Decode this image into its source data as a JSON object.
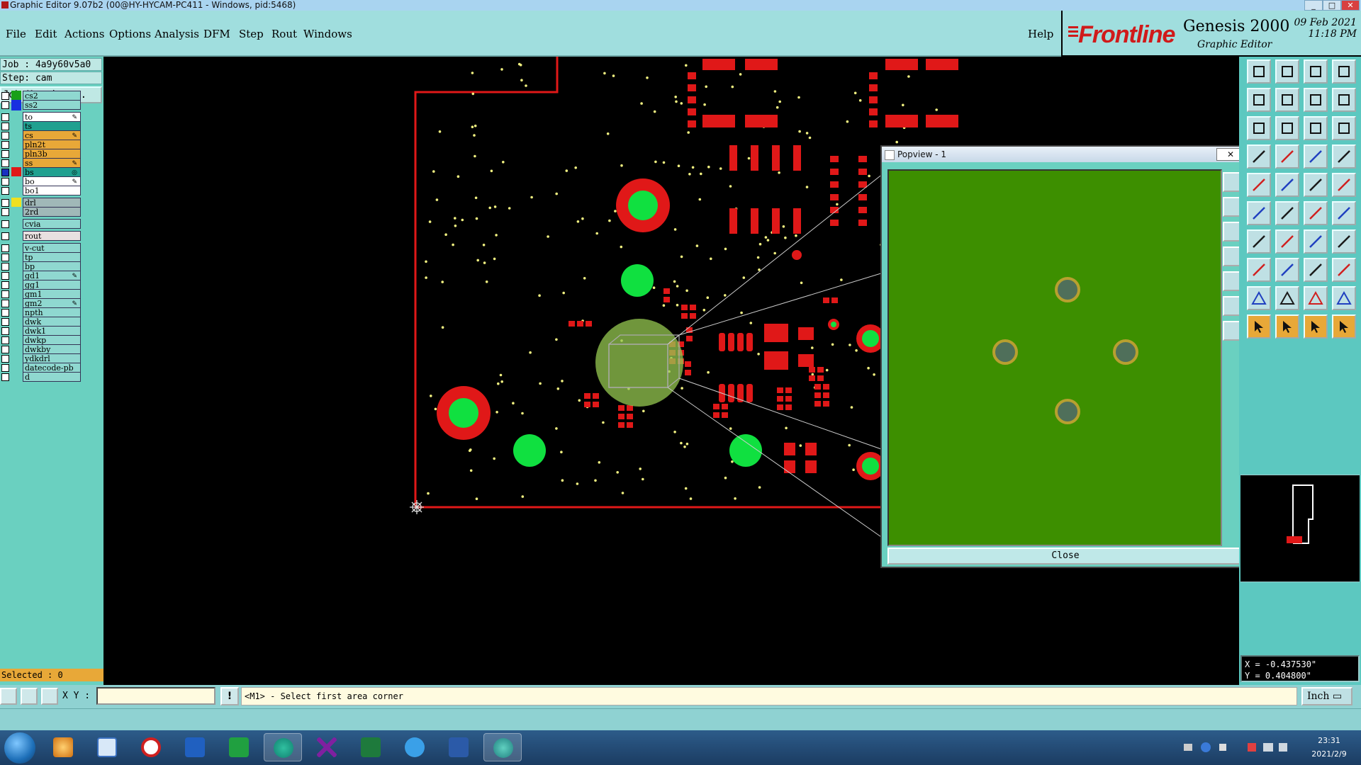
{
  "window": {
    "title": "Graphic Editor 9.07b2 (00@HY-HYCAM-PC411 - Windows, pid:5468)",
    "controls": [
      "_",
      "□",
      "✕"
    ]
  },
  "menu": [
    "File",
    "Edit",
    "Actions",
    "Options",
    "Analysis",
    "DFM",
    "Step",
    "Rout",
    "Windows"
  ],
  "help": "Help",
  "brand": {
    "logo": "Frontline",
    "product": "Genesis 2000",
    "subtitle": "Graphic Editor",
    "date_line1": "09 Feb 2021",
    "date_line2": "11:18 PM"
  },
  "job": {
    "job_label": "Job : 4a9y60v5a0",
    "step_label": "Step: cam",
    "matrix_button": "Job Matrix ..."
  },
  "layers": [
    {
      "name": "cs2",
      "swatch": "#18a018",
      "bg": "#8fd8d0",
      "mark": ""
    },
    {
      "name": "ss2",
      "swatch": "#1830e0",
      "bg": "#8fd8d0",
      "mark": ""
    },
    {
      "name": "to",
      "swatch": "",
      "bg": "#ffffff",
      "mark": "✎"
    },
    {
      "name": "ts",
      "swatch": "",
      "bg": "#20a090",
      "mark": ""
    },
    {
      "name": "cs",
      "swatch": "",
      "bg": "#e8a838",
      "mark": "✎"
    },
    {
      "name": "pln2t",
      "swatch": "",
      "bg": "#e8a838",
      "mark": ""
    },
    {
      "name": "pln3b",
      "swatch": "",
      "bg": "#e8a838",
      "mark": ""
    },
    {
      "name": "ss",
      "swatch": "",
      "bg": "#e8a838",
      "mark": "✎"
    },
    {
      "name": "bs",
      "swatch": "#e01818",
      "bg": "#20a090",
      "mark": "◎"
    },
    {
      "name": "bo",
      "swatch": "",
      "bg": "#ffffff",
      "mark": "✎"
    },
    {
      "name": "bo1",
      "swatch": "",
      "bg": "#ffffff",
      "mark": ""
    },
    {
      "name": "drl",
      "swatch": "#f0e020",
      "bg": "#a0b8b8",
      "mark": ""
    },
    {
      "name": "2rd",
      "swatch": "",
      "bg": "#a0b8b8",
      "mark": ""
    },
    {
      "name": "cvia",
      "swatch": "",
      "bg": "#8fd8d0",
      "mark": ""
    },
    {
      "name": "rout",
      "swatch": "",
      "bg": "#e8e0e0",
      "mark": ""
    },
    {
      "name": "v-cut",
      "swatch": "",
      "bg": "#8fd8d0",
      "mark": ""
    },
    {
      "name": "tp",
      "swatch": "",
      "bg": "#8fd8d0",
      "mark": ""
    },
    {
      "name": "bp",
      "swatch": "",
      "bg": "#8fd8d0",
      "mark": ""
    },
    {
      "name": "gd1",
      "swatch": "",
      "bg": "#8fd8d0",
      "mark": "✎"
    },
    {
      "name": "gg1",
      "swatch": "",
      "bg": "#8fd8d0",
      "mark": ""
    },
    {
      "name": "gm1",
      "swatch": "",
      "bg": "#8fd8d0",
      "mark": ""
    },
    {
      "name": "gm2",
      "swatch": "",
      "bg": "#8fd8d0",
      "mark": "✎"
    },
    {
      "name": "npth",
      "swatch": "",
      "bg": "#8fd8d0",
      "mark": ""
    },
    {
      "name": "dwk",
      "swatch": "",
      "bg": "#8fd8d0",
      "mark": ""
    },
    {
      "name": "dwk1",
      "swatch": "",
      "bg": "#8fd8d0",
      "mark": ""
    },
    {
      "name": "dwkp",
      "swatch": "",
      "bg": "#8fd8d0",
      "mark": ""
    },
    {
      "name": "dwkby",
      "swatch": "",
      "bg": "#8fd8d0",
      "mark": ""
    },
    {
      "name": "ydkdrl",
      "swatch": "",
      "bg": "#8fd8d0",
      "mark": ""
    },
    {
      "name": "datecode-pb",
      "swatch": "",
      "bg": "#8fd8d0",
      "mark": ""
    },
    {
      "name": "d",
      "swatch": "",
      "bg": "#8fd8d0",
      "mark": ""
    }
  ],
  "selected_label": "Selected : 0",
  "coords": {
    "x": "X = -0.437530\"",
    "y": "Y = 0.404800\""
  },
  "status": {
    "xy_label": "X Y :",
    "xy_value": "",
    "warn_icon": "!",
    "prompt": "<M1> - Select first area corner",
    "units": "Inch ▭"
  },
  "popview": {
    "title": "Popview - 1",
    "close_x": "✕",
    "close_button": "Close"
  },
  "taskbar": {
    "time": "23:31",
    "date": "2021/2/9",
    "apps": [
      "start-orb",
      "app-shell",
      "notepad",
      "app-g",
      "save-disk",
      "app-p",
      "eye-viewer",
      "app-x",
      "excel",
      "app-bird",
      "word",
      "genesis-eye"
    ]
  },
  "toolbar_icons": [
    "open-icon",
    "save-icon",
    "home-icon",
    "window-icon",
    "import-icon",
    "export-icon",
    "mirror-icon",
    "rotate-icon",
    "fit-icon",
    "zoom-fit-icon",
    "scale-icon",
    "help-icon",
    "layer-icon",
    "grid-icon",
    "snap-icon",
    "measure-icon",
    "pad-icon",
    "line-icon",
    "ruler-icon",
    "circle-icon",
    "node-icon",
    "cross-icon",
    "connect-icon",
    "link-icon",
    "angle-icon",
    "slash-icon",
    "arc-icon",
    "text-icon",
    "split-icon",
    "minus-icon",
    "clamp-icon",
    "gear-icon",
    "triangle-icon",
    "peak-icon",
    "tri-fill-icon",
    "tri-outline-icon",
    "pointer-icon",
    "select-icon",
    "edit-pointer-icon",
    "multi-select-icon"
  ]
}
